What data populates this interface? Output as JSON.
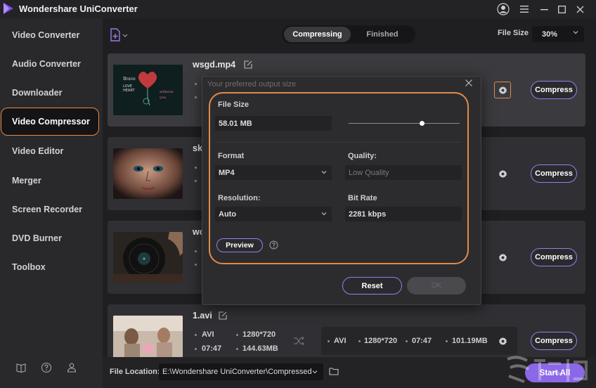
{
  "app": {
    "title": "Wondershare UniConverter"
  },
  "window_controls": [
    "account-icon",
    "menu-icon",
    "minimize-icon",
    "maximize-icon",
    "close-icon"
  ],
  "sidebar": {
    "items": [
      {
        "label": "Video Converter",
        "active": false
      },
      {
        "label": "Audio Converter",
        "active": false
      },
      {
        "label": "Downloader",
        "active": false
      },
      {
        "label": "Video Compressor",
        "active": true
      },
      {
        "label": "Video Editor",
        "active": false
      },
      {
        "label": "Merger",
        "active": false
      },
      {
        "label": "Screen Recorder",
        "active": false
      },
      {
        "label": "DVD Burner",
        "active": false
      },
      {
        "label": "Toolbox",
        "active": false
      }
    ],
    "footer_icons": [
      "book-icon",
      "help-icon",
      "users-icon"
    ]
  },
  "tabs": {
    "compressing": "Compressing",
    "finished": "Finished"
  },
  "file_size": {
    "label": "File Size",
    "value": "30%"
  },
  "files": [
    {
      "name": "wsgd.mp4",
      "compress_label": "Compress"
    },
    {
      "name": "sk",
      "compress_label": "Compress"
    },
    {
      "name": "wo",
      "compress_label": "Compress"
    },
    {
      "name": "1.avi",
      "src": {
        "format": "AVI",
        "resolution": "1280*720",
        "duration": "07:47",
        "size": "144.63MB"
      },
      "target": {
        "format": "AVI",
        "resolution": "1280*720",
        "duration": "07:47",
        "size": "101.19MB"
      },
      "compress_label": "Compress"
    }
  ],
  "bottom": {
    "file_location_label": "File Location:",
    "file_location_value": "E:\\Wondershare UniConverter\\Compressed",
    "start_all": "Start All"
  },
  "modal": {
    "title": "Your preferred output size",
    "file_size_label": "File Size",
    "file_size_value": "58.01 MB",
    "slider_fraction": 0.66,
    "format_label": "Format",
    "format_value": "MP4",
    "quality_label": "Quality:",
    "quality_placeholder": "Low Quality",
    "resolution_label": "Resolution:",
    "resolution_value": "Auto",
    "bitrate_label": "Bit Rate",
    "bitrate_value": "2281 kbps",
    "preview": "Preview",
    "reset": "Reset",
    "ok": "OK"
  },
  "colors": {
    "accent": "#9d7ae8",
    "highlight": "#e38a4a",
    "start_all": "#8b68e6"
  }
}
